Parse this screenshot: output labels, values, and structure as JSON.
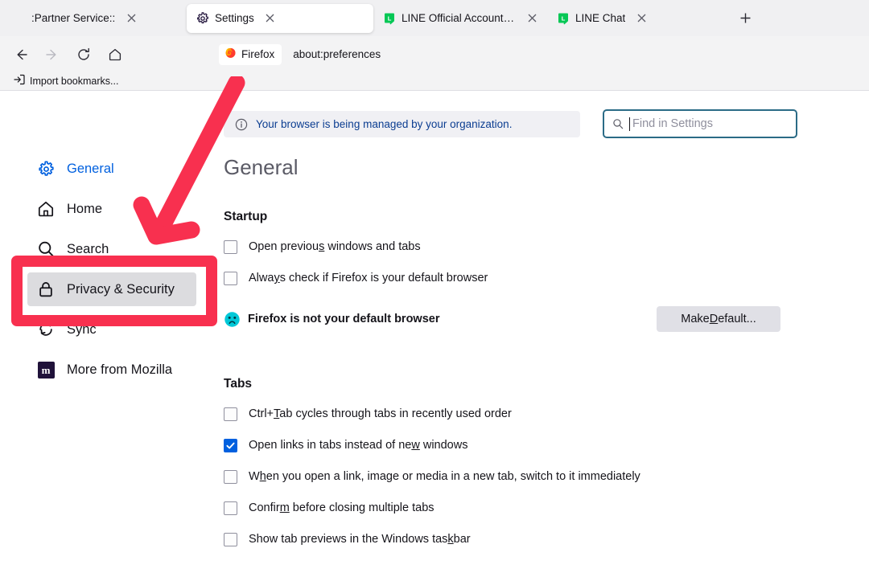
{
  "window": {
    "tabs": [
      {
        "title": ":Partner Service::",
        "favicon": "none",
        "active": false,
        "has_close": true
      },
      {
        "title": "Settings",
        "favicon": "gear-icon",
        "active": true,
        "has_close": true
      },
      {
        "title": "LINE Official Account Manager",
        "favicon": "line-icon",
        "active": false,
        "has_close": true
      },
      {
        "title": "LINE Chat",
        "favicon": "line-icon",
        "active": false,
        "has_close": true
      }
    ],
    "new_tab_label": "+",
    "nav": {
      "back": "back-icon",
      "forward": "forward-icon",
      "reload": "reload-icon",
      "home": "home-icon"
    },
    "urlbar": {
      "chip_label": "Firefox",
      "chip_icon": "firefox-logo-icon",
      "url": "about:preferences"
    },
    "bookmarks": [
      {
        "label": "Import bookmarks...",
        "icon": "import-icon"
      }
    ]
  },
  "sidebar": {
    "items": [
      {
        "label": "General",
        "icon": "gear-icon",
        "state": "selected"
      },
      {
        "label": "Home",
        "icon": "home-icon",
        "state": "normal"
      },
      {
        "label": "Search",
        "icon": "search-icon",
        "state": "normal"
      },
      {
        "label": "Privacy & Security",
        "icon": "lock-icon",
        "state": "hovered"
      },
      {
        "label": "Sync",
        "icon": "sync-icon",
        "state": "normal"
      },
      {
        "label": "More from Mozilla",
        "icon": "mozilla-icon",
        "state": "normal"
      }
    ]
  },
  "main": {
    "notice": {
      "icon": "info-icon",
      "text": "Your browser is being managed by your organization."
    },
    "search": {
      "icon": "search-icon",
      "placeholder": "Find in Settings",
      "value": "",
      "focused": true
    },
    "page_title": "General",
    "sections": [
      {
        "heading": "Startup",
        "checkboxes": [
          {
            "label_before": "Open previou",
            "accesskey": "s",
            "label_after": " windows and tabs",
            "checked": false
          },
          {
            "label_before": "Alwa",
            "accesskey": "y",
            "label_after": "s check if Firefox is your default browser",
            "checked": false
          }
        ]
      },
      {
        "heading": "Tabs",
        "checkboxes": [
          {
            "label_before": "Ctrl+",
            "accesskey": "T",
            "label_after": "ab cycles through tabs in recently used order",
            "checked": false
          },
          {
            "label_before": "Open links in tabs instead of ne",
            "accesskey": "w",
            "label_after": " windows",
            "checked": true
          },
          {
            "label_before": "W",
            "accesskey": "h",
            "label_after": "en you open a link, image or media in a new tab, switch to it immediately",
            "checked": false
          },
          {
            "label_before": "Confir",
            "accesskey": "m",
            "label_after": " before closing multiple tabs",
            "checked": false
          },
          {
            "label_before": "Show tab previews in the Windows tas",
            "accesskey": "k",
            "label_after": "bar",
            "checked": false
          }
        ]
      }
    ],
    "default_browser": {
      "icon": "sad-face-icon",
      "status_text": "Firefox is not your default browser",
      "button_before": "Make ",
      "button_accesskey": "D",
      "button_after": "efault..."
    }
  },
  "annotations": {
    "highlight_box": {
      "target": "Privacy & Security",
      "color": "#f8304f"
    },
    "arrow": {
      "points_to": "Privacy & Security",
      "color": "#f8304f"
    }
  },
  "colors": {
    "accent_blue": "#0060df",
    "annotation_red": "#f8304f",
    "chrome_gray": "#f3f3f4",
    "line_green": "#06c755"
  }
}
